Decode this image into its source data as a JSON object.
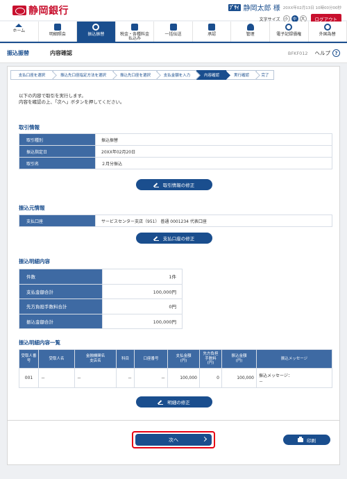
{
  "header": {
    "bank_name": "静岡銀行",
    "user_badge": "ﾌﾞｻｲ",
    "user_name": "静岡太郎 様",
    "last_login": "20XX年02月13日 10時00分00秒",
    "font_size_label": "文字サイズ",
    "font_sizes": [
      "小",
      "中",
      "大"
    ],
    "logout_label": "ログアウト"
  },
  "nav": {
    "items": [
      {
        "label": "ホーム",
        "icon": "home-icon"
      },
      {
        "label": "明細照会",
        "icon": "statement-icon"
      },
      {
        "label": "振込振替",
        "icon": "transfer-icon",
        "active": true
      },
      {
        "label": "税金・各種料金\n払込み",
        "icon": "tax-icon"
      },
      {
        "label": "一括伝送",
        "icon": "batch-icon"
      },
      {
        "label": "承認",
        "icon": "approval-icon"
      },
      {
        "label": "管理",
        "icon": "admin-icon"
      },
      {
        "label": "電子記録債権",
        "icon": "e-bond-icon"
      },
      {
        "label": "外国為替",
        "icon": "forex-icon"
      }
    ]
  },
  "page_head": {
    "title": "振込振替",
    "subtitle": "内容確認",
    "code": "BFKF012",
    "help_label": "ヘルプ"
  },
  "steps": [
    "支払口座を選択",
    "振込先口座指定方法を選択",
    "振込先口座を選択",
    "支払金額を入力",
    "内容確認",
    "実行確認",
    "完了"
  ],
  "intro": {
    "line1": "以下の内容で取引を実行します。",
    "line2": "内容を確認の上、「次へ」ボタンを押してください。"
  },
  "transaction_info": {
    "title": "取引情報",
    "rows": [
      {
        "label": "取引種別",
        "value": "振込振替"
      },
      {
        "label": "振込指定日",
        "value": "20XX年02月20日"
      },
      {
        "label": "取引名",
        "value": "２月分振込"
      }
    ],
    "edit_button": "取引情報の修正"
  },
  "source_info": {
    "title": "振込元情報",
    "rows": [
      {
        "label": "支払口座",
        "value": "サービスセンター支店（951） 普通 0001234 代表口座"
      }
    ],
    "edit_button": "支払口座の修正"
  },
  "detail_summary": {
    "title": "振込明細内容",
    "rows": [
      {
        "label": "件数",
        "value": "1件"
      },
      {
        "label": "支払金額合計",
        "value": "100,000円"
      },
      {
        "label": "先方負担手数料合計",
        "value": "0円"
      },
      {
        "label": "振込金額合計",
        "value": "100,000円"
      }
    ]
  },
  "detail_list": {
    "title": "振込明細内容一覧",
    "headers": [
      "受取人番号",
      "受取人名",
      "金融機関名\n支店名",
      "科目",
      "口座番号",
      "支払金額\n(円)",
      "先方負担\n手数料\n(円)",
      "振込金額\n(円)",
      "振込メッセージ"
    ],
    "rows": [
      [
        "001",
        "－",
        "－",
        "－",
        "－",
        "100,000",
        "0",
        "100,000",
        "振込メッセージ：\n－"
      ]
    ],
    "edit_button": "明細の修正"
  },
  "footer": {
    "next_label": "次へ",
    "print_label": "印刷"
  },
  "colors": {
    "brand_red": "#c8102e",
    "primary_blue": "#1a4e8e",
    "table_header": "#3e6aa3",
    "highlight": "#e60012"
  }
}
